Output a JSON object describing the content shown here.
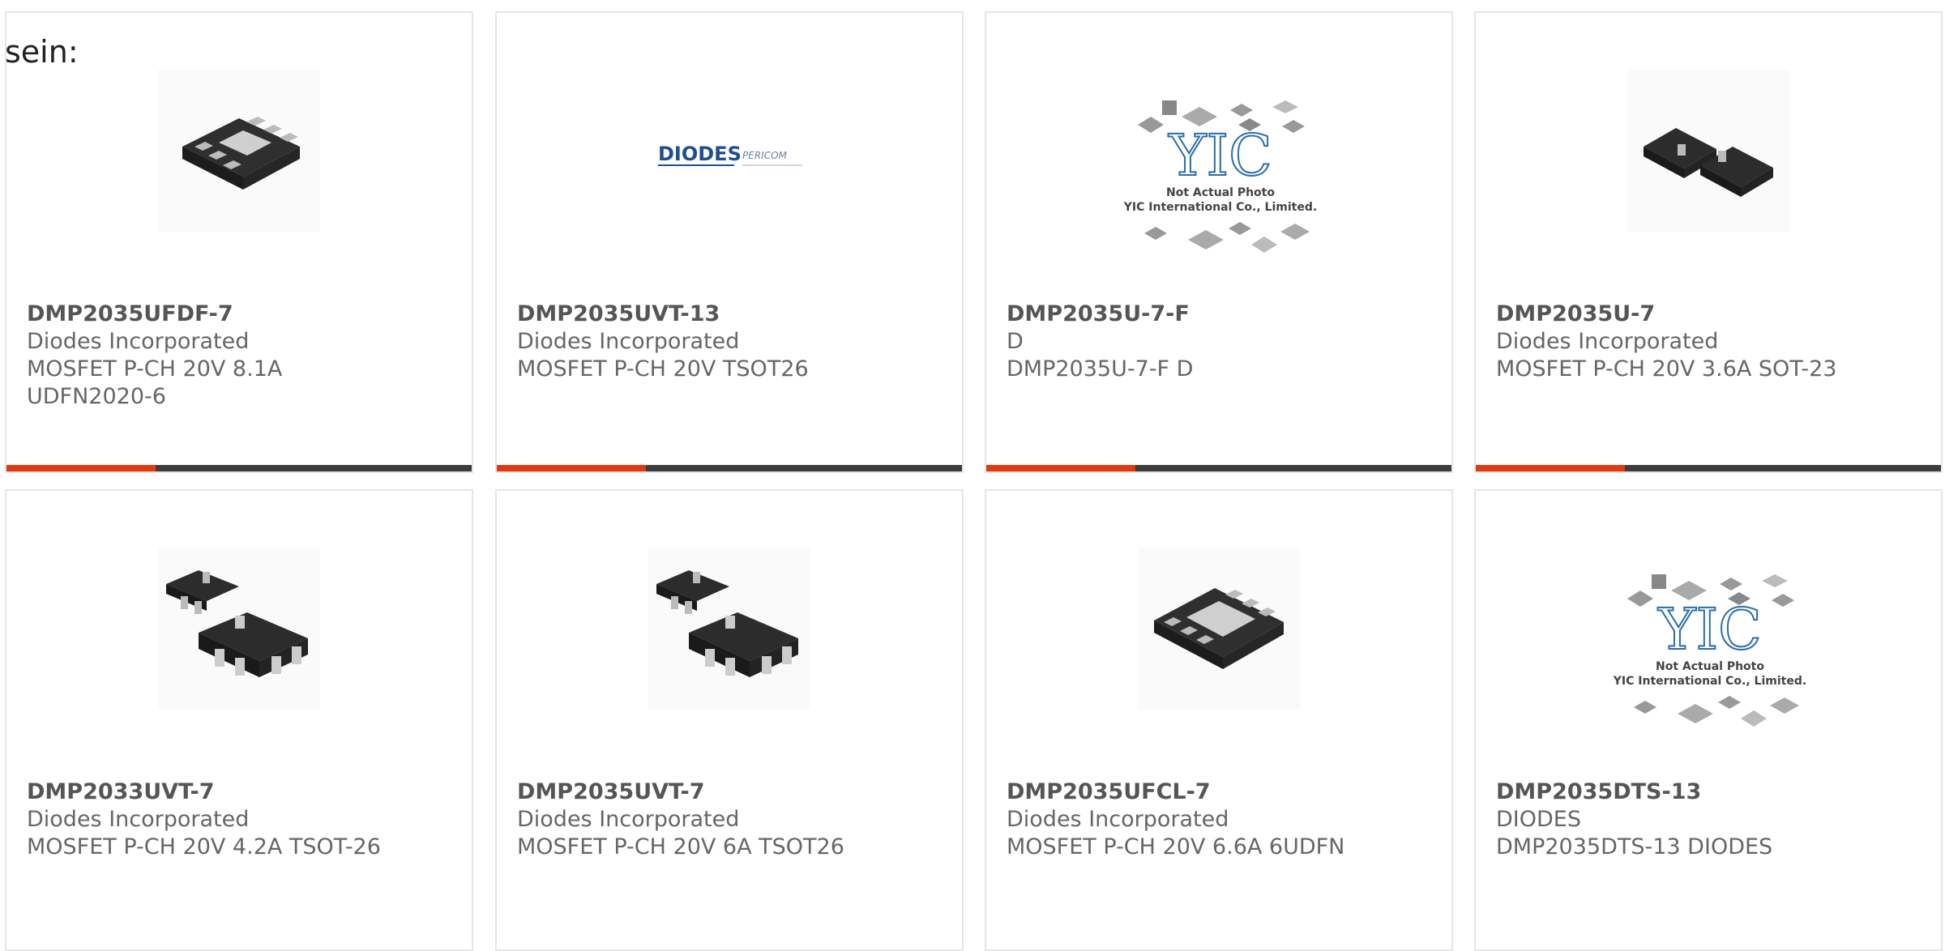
{
  "intro_text": "sein:",
  "brand": {
    "logo_text": "DIODES",
    "logo_sub": "PERICOM"
  },
  "placeholder": {
    "line1": "Not Actual Photo",
    "line2": "YIC International Co., Limited.",
    "mark": "YIC"
  },
  "colors": {
    "accent": "#e03a12",
    "bar": "#3d3d3d"
  },
  "products": [
    {
      "part": "DMP2035UFDF-7",
      "maker": "Diodes Incorporated",
      "desc": "MOSFET P-CH 20V 8.1A",
      "desc2": "UDFN2020-6",
      "image": "udfn-6-package"
    },
    {
      "part": "DMP2035UVT-13",
      "maker": "Diodes Incorporated",
      "desc": "MOSFET P-CH 20V TSOT26",
      "desc2": "",
      "image": "brand-logo"
    },
    {
      "part": "DMP2035U-7-F",
      "maker": "D",
      "desc": "DMP2035U-7-F D",
      "desc2": "",
      "image": "not-actual-photo"
    },
    {
      "part": "DMP2035U-7",
      "maker": "Diodes Incorporated",
      "desc": "MOSFET P-CH 20V 3.6A SOT-23",
      "desc2": "",
      "image": "sot-23-package"
    },
    {
      "part": "DMP2033UVT-7",
      "maker": "Diodes Incorporated",
      "desc": "MOSFET P-CH 20V 4.2A TSOT-26",
      "desc2": "",
      "image": "tsot-26-package"
    },
    {
      "part": "DMP2035UVT-7",
      "maker": "Diodes Incorporated",
      "desc": "MOSFET P-CH 20V 6A TSOT26",
      "desc2": "",
      "image": "tsot-26-package"
    },
    {
      "part": "DMP2035UFCL-7",
      "maker": "Diodes Incorporated",
      "desc": "MOSFET P-CH 20V 6.6A 6UDFN",
      "desc2": "",
      "image": "udfn-6-package"
    },
    {
      "part": "DMP2035DTS-13",
      "maker": "DIODES",
      "desc": "DMP2035DTS-13 DIODES",
      "desc2": "",
      "image": "not-actual-photo"
    }
  ]
}
